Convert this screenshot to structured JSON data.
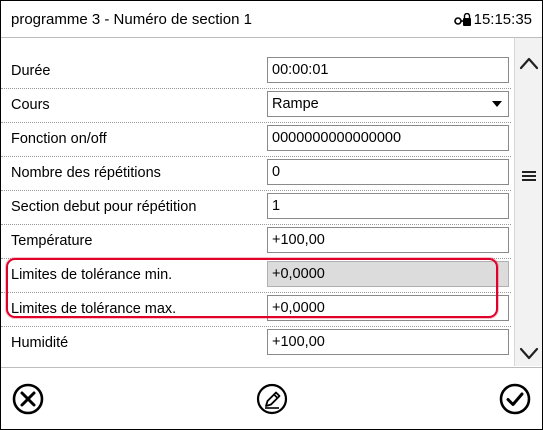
{
  "header": {
    "title": "programme 3 - Numéro de section 1",
    "time": "15:15:35",
    "lock_icon": "key-lock-icon"
  },
  "rows": [
    {
      "label": "Durée",
      "value": "00:00:01"
    },
    {
      "label": "Cours",
      "value": "Rampe"
    },
    {
      "label": "Fonction on/off",
      "value": "0000000000000000"
    },
    {
      "label": "Nombre des répétitions",
      "value": "0"
    },
    {
      "label": "Section debut pour répétition",
      "value": "1"
    },
    {
      "label": "Température",
      "value": "+100,00"
    },
    {
      "label": "Limites de tolérance min.",
      "value": "+0,0000"
    },
    {
      "label": "Limites de tolérance max.",
      "value": "+0,0000"
    },
    {
      "label": "Humidité",
      "value": "+100,00"
    }
  ],
  "scrollbar": {
    "up_icon": "chevron-up-icon",
    "menu_icon": "hamburger-menu-icon",
    "down_icon": "chevron-down-icon"
  },
  "footer": {
    "cancel_icon": "cancel-x-icon",
    "edit_icon": "pencil-edit-icon",
    "confirm_icon": "checkmark-confirm-icon"
  },
  "colors": {
    "highlight": "#e0002a",
    "disabled_field": "#dcdcdc"
  }
}
